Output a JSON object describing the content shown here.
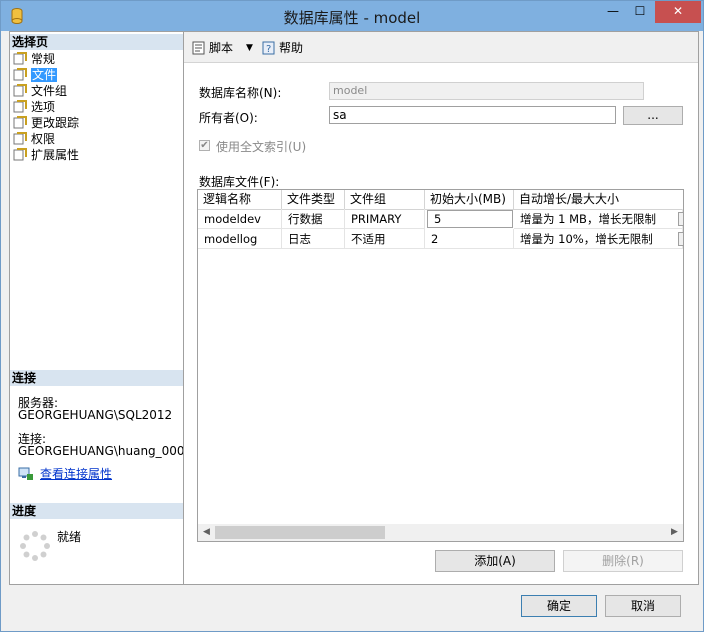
{
  "window": {
    "title": "数据库属性 - model",
    "close_glyph": "✕",
    "min_glyph": "—",
    "max_glyph": "☐"
  },
  "left": {
    "select_page_header": "选择页",
    "nav": [
      {
        "label": "常规",
        "icon": "page-icon"
      },
      {
        "label": "文件",
        "icon": "page-icon",
        "selected": true
      },
      {
        "label": "文件组",
        "icon": "page-icon"
      },
      {
        "label": "选项",
        "icon": "page-icon"
      },
      {
        "label": "更改跟踪",
        "icon": "page-icon"
      },
      {
        "label": "权限",
        "icon": "page-icon"
      },
      {
        "label": "扩展属性",
        "icon": "page-icon"
      }
    ],
    "connection_header": "连接",
    "server_label": "服务器:",
    "server_value": "GEORGEHUANG\\SQL2012",
    "connection_label": "连接:",
    "connection_value": "GEORGEHUANG\\huang_000",
    "view_conn_link": "查看连接属性",
    "progress_header": "进度",
    "progress_status": "就绪"
  },
  "toolbar": {
    "script_label": "脚本",
    "help_label": "帮助"
  },
  "form": {
    "db_name_label": "数据库名称(N):",
    "db_name_value": "model",
    "owner_label": "所有者(O):",
    "owner_value": "sa",
    "browse_label": "...",
    "fulltext_label": "使用全文索引(U)",
    "fulltext_checked": true,
    "files_label": "数据库文件(F):"
  },
  "grid": {
    "headers": [
      "逻辑名称",
      "文件类型",
      "文件组",
      "初始大小(MB)",
      "自动增长/最大大小"
    ],
    "rows": [
      [
        "modeldev",
        "行数据",
        "PRIMARY",
        "5",
        "增量为 1 MB，增长无限制"
      ],
      [
        "modellog",
        "日志",
        "不适用",
        "2",
        "增量为 10%，增长无限制"
      ]
    ]
  },
  "buttons": {
    "add": "添加(A)",
    "remove": "删除(R)",
    "ok": "确定",
    "cancel": "取消"
  },
  "colors": {
    "titlebar": "#7fb0e0",
    "selection": "#3399ff",
    "close": "#c75050",
    "section_header": "#d8e4f0"
  }
}
